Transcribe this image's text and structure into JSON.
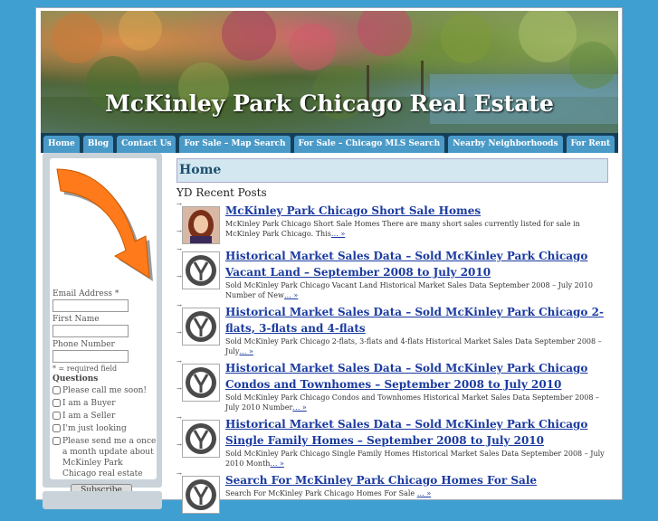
{
  "header": {
    "title": "McKinley Park Chicago Real Estate"
  },
  "nav": {
    "items": [
      "Home",
      "Blog",
      "Contact Us",
      "For Sale – Map Search",
      "For Sale – Chicago MLS Search",
      "Nearby Neighborhoods",
      "For Rent"
    ]
  },
  "sidebar": {
    "email_label": "Email Address *",
    "first_name_label": "First Name",
    "phone_label": "Phone Number",
    "required_note": "* = required field",
    "questions_label": "Questions",
    "options": [
      "Please call me soon!",
      "I am a Buyer",
      "I am a Seller",
      "I'm just looking",
      "Please send me a once a month update about McKinley Park Chicago real estate"
    ],
    "subscribe_label": "Subscribe Now!"
  },
  "main": {
    "page_title": "Home",
    "section_title": "YD Recent Posts",
    "posts": [
      {
        "title": "McKinley Park Chicago Short Sale Homes",
        "excerpt": "McKinley Park Chicago Short Sale Homes There are many short sales currently listed for sale in McKinley Park Chicago.  This",
        "more": "… »",
        "thumb": "agent-photo"
      },
      {
        "title": "Historical Market Sales Data – Sold McKinley Park Chicago Vacant Land – September 2008 to July 2010",
        "excerpt": "Sold McKinley Park Chicago Vacant Land Historical Market Sales Data September 2008 – July 2010 Number of New",
        "more": "… »",
        "thumb": "yd-logo"
      },
      {
        "title": "Historical Market Sales Data – Sold McKinley Park Chicago 2-flats, 3-flats and 4-flats",
        "excerpt": "Sold McKinley Park Chicago 2-flats, 3-flats and 4-flats Historical Market Sales Data September 2008 – July",
        "more": "… »",
        "thumb": "yd-logo"
      },
      {
        "title": "Historical Market Sales Data – Sold McKinley Park Chicago Condos and Townhomes – September 2008 to July 2010",
        "excerpt": "Sold McKinley Park Chicago Condos and Townhomes Historical Market Sales Data September 2008 – July 2010 Number",
        "more": "… »",
        "thumb": "yd-logo"
      },
      {
        "title": "Historical Market Sales Data – Sold McKinley Park Chicago Single Family Homes – September 2008 to July 2010",
        "excerpt": "Sold McKinley Park Chicago Single Family Homes Historical Market Sales Data September 2008 – July 2010 Month",
        "more": "… »",
        "thumb": "yd-logo"
      },
      {
        "title": "Search For McKinley Park Chicago Homes For Sale",
        "excerpt": "Search For McKinley Park Chicago Homes For Sale",
        "more": "… »",
        "thumb": "yd-logo"
      }
    ]
  },
  "colors": {
    "background": "#3f9fd0",
    "nav_bar": "#153f59",
    "nav_tab": "#4a9ac8",
    "link": "#1a3aa0",
    "title_box": "#d3e7f1"
  }
}
